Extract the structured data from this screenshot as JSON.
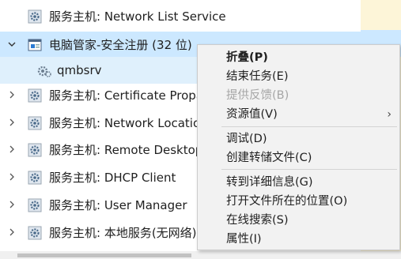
{
  "processes": [
    {
      "label": "服务主机: Network List Service",
      "icon": "gear-icon",
      "expanded": false,
      "selected": false
    },
    {
      "label": "电脑管家-安全注册 (32 位)",
      "icon": "app-window-icon",
      "expanded": true,
      "selected": true
    },
    {
      "label": "qmbsrv",
      "icon": "gear-icon",
      "child": true
    },
    {
      "label": "服务主机: Certificate Propa",
      "icon": "gear-icon",
      "expanded": false
    },
    {
      "label": "服务主机: Network Locatio",
      "icon": "gear-icon",
      "expanded": false
    },
    {
      "label": "服务主机: Remote Desktop",
      "icon": "gear-icon",
      "expanded": false
    },
    {
      "label": "服务主机: DHCP Client",
      "icon": "gear-icon",
      "expanded": false
    },
    {
      "label": "服务主机: User Manager",
      "icon": "gear-icon",
      "expanded": false
    },
    {
      "label": "服务主机: 本地服务(无网络)",
      "icon": "gear-icon",
      "expanded": false
    }
  ],
  "context_menu": {
    "items": [
      {
        "label": "折叠(P)",
        "bold": true
      },
      {
        "label": "结束任务(E)"
      },
      {
        "label": "提供反馈(B)",
        "disabled": true
      },
      {
        "label": "资源值(V)",
        "submenu": true
      },
      {
        "separator": true
      },
      {
        "label": "调试(D)"
      },
      {
        "label": "创建转储文件(C)"
      },
      {
        "separator": true
      },
      {
        "label": "转到详细信息(G)"
      },
      {
        "label": "打开文件所在的位置(O)"
      },
      {
        "label": "在线搜索(S)"
      },
      {
        "label": "属性(I)"
      }
    ],
    "submenu_arrow": "›"
  },
  "colors": {
    "selected_row": "#cce8ff",
    "child_row": "#dff0fc",
    "menu_bg": "#f2f2f2",
    "disabled_text": "#a6a6a6",
    "column_highlight": "#fdf5d8"
  }
}
